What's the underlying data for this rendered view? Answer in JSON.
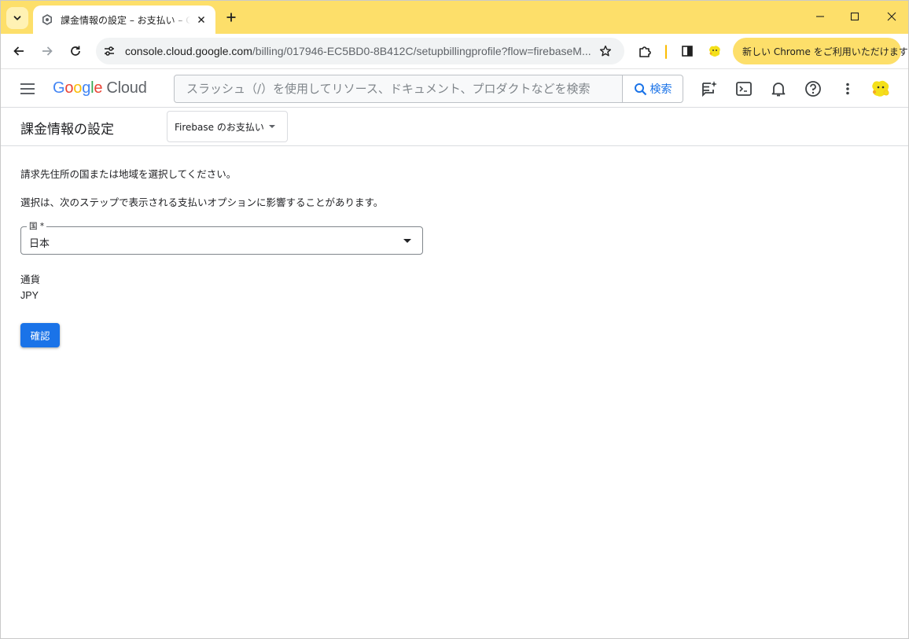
{
  "browser": {
    "tab_title": "課金情報の設定 – お支払い – Google Cloud",
    "url_host": "console.cloud.google.com",
    "url_path": "/billing/017946-EC5BD0-8B412C/setupbillingprofile?flow=firebaseM...",
    "update_label": "新しい Chrome をご利用いただけます",
    "accent_color": "#fddf6a"
  },
  "header": {
    "logo_google": "Google",
    "logo_cloud": "Cloud",
    "search_placeholder": "スラッシュ（/）を使用してリソース、ドキュメント、プロダクトなどを検索",
    "search_button": "検索"
  },
  "page": {
    "title": "課金情報の設定",
    "billing_account": "Firebase のお支払い",
    "instruction_1": "請求先住所の国または地域を選択してください。",
    "instruction_2": "選択は、次のステップで表示される支払いオプションに影響することがあります。",
    "country_label": "国 *",
    "country_value": "日本",
    "currency_label": "通貨",
    "currency_value": "JPY",
    "confirm_button": "確認"
  }
}
